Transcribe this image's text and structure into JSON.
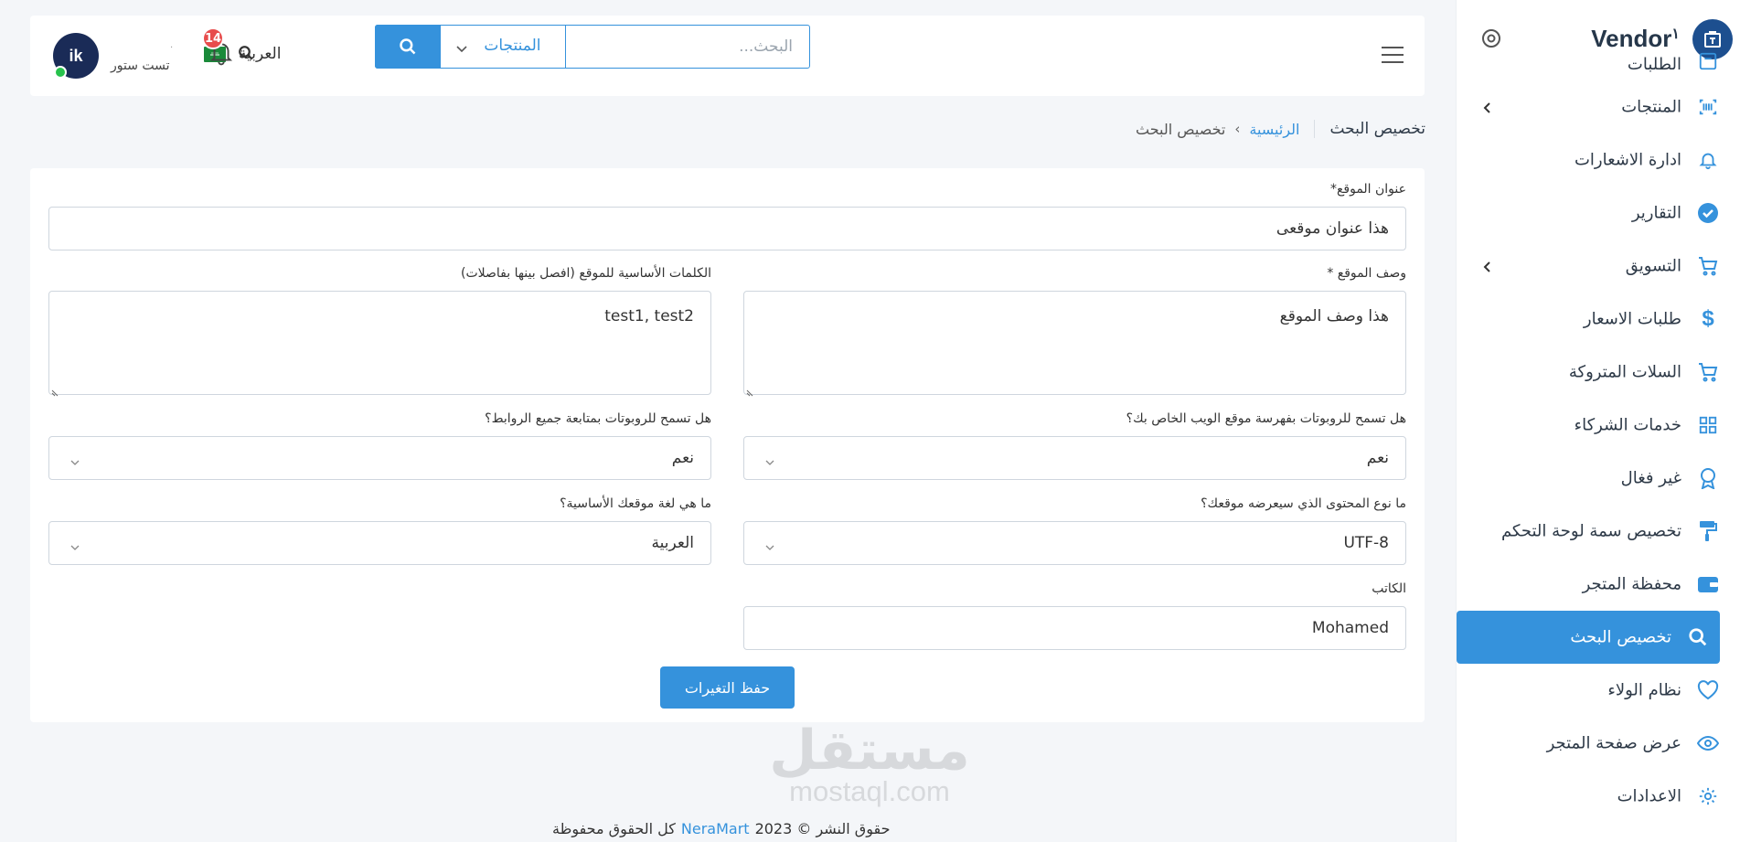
{
  "sidebar": {
    "brand": "Vendor",
    "brand_mark": "۱",
    "items": [
      {
        "label": "الطلبات",
        "icon": "orders-icon",
        "has_children": false
      },
      {
        "label": "المنتجات",
        "icon": "barcode-icon",
        "has_children": true
      },
      {
        "label": "ادارة الاشعارات",
        "icon": "bell-icon",
        "has_children": false
      },
      {
        "label": "التقارير",
        "icon": "check-circle-icon",
        "has_children": false
      },
      {
        "label": "التسويق",
        "icon": "cart-icon",
        "has_children": true
      },
      {
        "label": "طلبات الاسعار",
        "icon": "dollar-icon",
        "has_children": false
      },
      {
        "label": "السلات المتروكة",
        "icon": "cart-icon",
        "has_children": false
      },
      {
        "label": "خدمات الشركاء",
        "icon": "grid-icon",
        "has_children": false
      },
      {
        "label": "غير فغال",
        "icon": "award-icon",
        "has_children": false
      },
      {
        "label": "تخصيص سمة لوحة التحكم",
        "icon": "paint-roller-icon",
        "has_children": false
      },
      {
        "label": "محفظة المتجر",
        "icon": "wallet-icon",
        "has_children": false
      },
      {
        "label": "تخصيص البحث",
        "icon": "search-icon",
        "has_children": false,
        "active": true
      },
      {
        "label": "نظام الولاء",
        "icon": "heart-icon",
        "has_children": false
      },
      {
        "label": "عرض صفحة المتجر",
        "icon": "eye-icon",
        "has_children": false
      },
      {
        "label": "الاعدادات",
        "icon": "gear-icon",
        "has_children": false
      }
    ]
  },
  "header": {
    "search_placeholder": "البحث...",
    "search_scope": "المنتجات",
    "language": "العربية",
    "notifications_count": "14",
    "store_name": "تست ستور",
    "store_sub": "·",
    "avatar_text": "ik"
  },
  "page": {
    "title": "تخصيص البحث",
    "breadcrumb_home": "الرئيسية",
    "breadcrumb_separator": "›",
    "breadcrumb_current": "تخصيص البحث"
  },
  "form": {
    "site_title_label": "عنوان الموقع*",
    "site_title_value": "هذا عنوان موقعى",
    "site_description_label": "وصف الموقع *",
    "site_description_value": "هذا وصف الموقع",
    "keywords_label": "الكلمات الأساسية للموقع (افصل بينها بفاصلات)",
    "keywords_value": "test1, test2",
    "robots_index_label": "هل تسمح للروبوتات بفهرسة موقع الويب الخاص بك؟",
    "robots_index_value": "نعم",
    "robots_follow_label": "هل تسمح للروبوتات بمتابعة جميع الروابط؟",
    "robots_follow_value": "نعم",
    "content_type_label": "ما نوع المحتوى الذي سيعرضه موقعك؟",
    "content_type_value": "UTF-8",
    "language_label": "ما هي لغة موقعك الأساسية؟",
    "language_value": "العربية",
    "author_label": "الكاتب",
    "author_value": "Mohamed",
    "save_label": "حفظ التغيرات"
  },
  "footer": {
    "copyright": "حقوق النشر © 2023",
    "brand_link": "NeraMart",
    "rights": "كل الحقوق محفوظة",
    "watermark_ar": "مستقل",
    "watermark_en": "mostaql.com"
  },
  "colors": {
    "accent": "#3592dc",
    "badge": "#e74c4c",
    "online": "#27c24c",
    "brand_logo": "#1d4f8f"
  }
}
